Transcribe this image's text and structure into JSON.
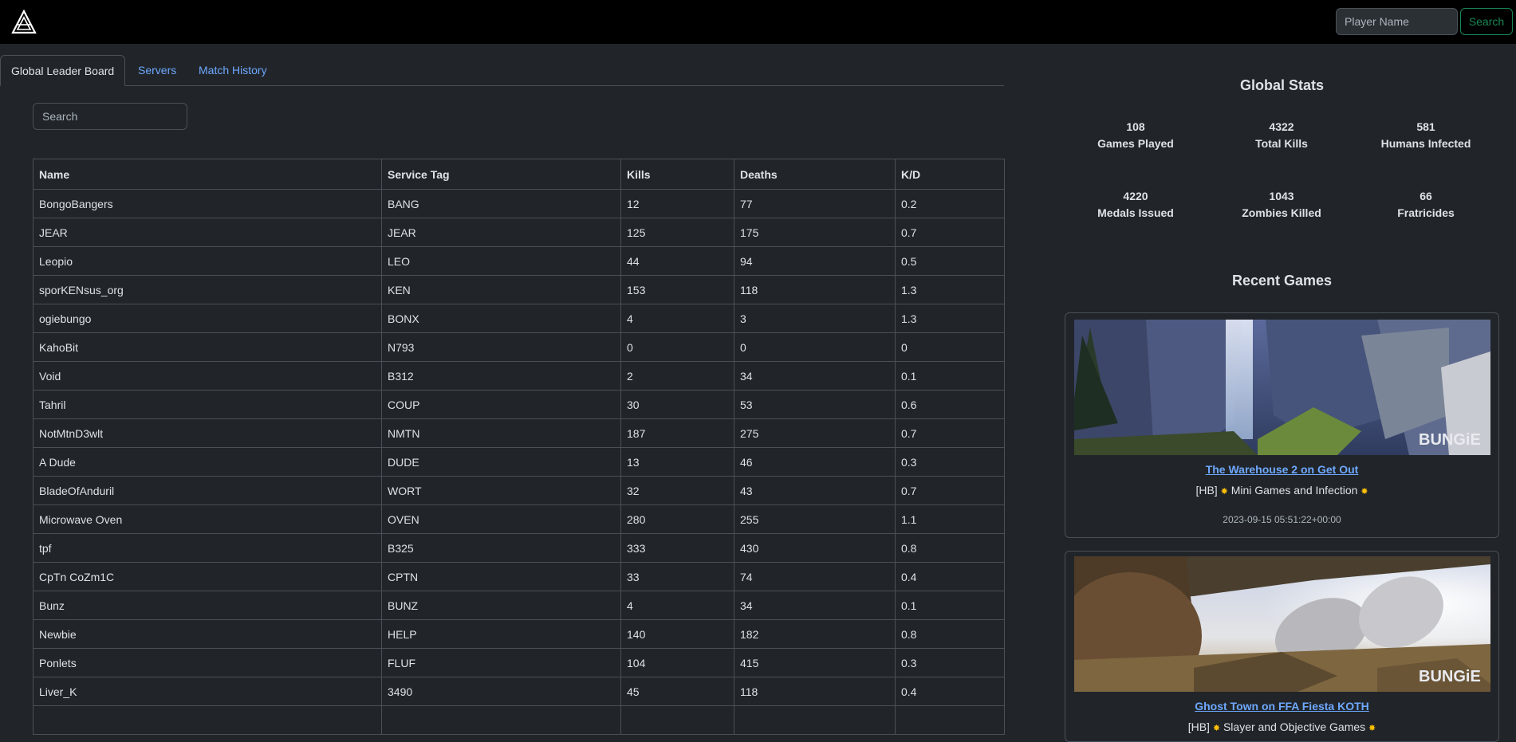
{
  "navbar": {
    "logo": "halo-triangle-logo-icon",
    "player_placeholder": "Player Name",
    "search_label": "Search",
    "search_color": "#198754"
  },
  "tabs": [
    {
      "label": "Global Leader Board",
      "active": true
    },
    {
      "label": "Servers",
      "active": false
    },
    {
      "label": "Match History",
      "active": false
    }
  ],
  "leaderboard": {
    "search_placeholder": "Search",
    "columns": [
      "Name",
      "Service Tag",
      "Kills",
      "Deaths",
      "K/D"
    ],
    "rows": [
      [
        "BongoBangers",
        "BANG",
        "12",
        "77",
        "0.2"
      ],
      [
        "JEAR",
        "JEAR",
        "125",
        "175",
        "0.7"
      ],
      [
        "Leopio",
        "LEO",
        "44",
        "94",
        "0.5"
      ],
      [
        "sporKENsus_org",
        "KEN",
        "153",
        "118",
        "1.3"
      ],
      [
        "ogiebungo",
        "BONX",
        "4",
        "3",
        "1.3"
      ],
      [
        "KahoBit",
        "N793",
        "0",
        "0",
        "0"
      ],
      [
        "Void",
        "B312",
        "2",
        "34",
        "0.1"
      ],
      [
        "Tahril",
        "COUP",
        "30",
        "53",
        "0.6"
      ],
      [
        "NotMtnD3wlt",
        "NMTN",
        "187",
        "275",
        "0.7"
      ],
      [
        "A Dude",
        "DUDE",
        "13",
        "46",
        "0.3"
      ],
      [
        "BladeOfAnduril",
        "WORT",
        "32",
        "43",
        "0.7"
      ],
      [
        "Microwave Oven",
        "OVEN",
        "280",
        "255",
        "1.1"
      ],
      [
        "tpf",
        "B325",
        "333",
        "430",
        "0.8"
      ],
      [
        "CpTn CoZm1C",
        "CPTN",
        "33",
        "74",
        "0.4"
      ],
      [
        "Bunz",
        "BUNZ",
        "4",
        "34",
        "0.1"
      ],
      [
        "Newbie",
        "HELP",
        "140",
        "182",
        "0.8"
      ],
      [
        "Ponlets",
        "FLUF",
        "104",
        "415",
        "0.3"
      ],
      [
        "Liver_K",
        "3490",
        "45",
        "118",
        "0.4"
      ],
      [
        "",
        "",
        "",
        "",
        ""
      ]
    ]
  },
  "global_stats": {
    "title": "Global Stats",
    "items": [
      {
        "value": "108",
        "label": "Games Played"
      },
      {
        "value": "4322",
        "label": "Total Kills"
      },
      {
        "value": "581",
        "label": "Humans Infected"
      },
      {
        "value": "4220",
        "label": "Medals Issued"
      },
      {
        "value": "1043",
        "label": "Zombies Killed"
      },
      {
        "value": "66",
        "label": "Fratricides"
      }
    ]
  },
  "recent_games": {
    "title": "Recent Games",
    "games": [
      {
        "map_link": "The Warehouse 2 on Get Out",
        "server_prefix": "[HB]",
        "server_name": "Mini Games and Infection",
        "timestamp": "2023-09-15 05:51:22+00:00",
        "watermark": "BUNGiE"
      },
      {
        "map_link": "Ghost Town on FFA Fiesta KOTH",
        "server_prefix": "[HB]",
        "server_name": "Slayer and Objective Games",
        "timestamp": "",
        "watermark": "BUNGiE"
      }
    ]
  }
}
